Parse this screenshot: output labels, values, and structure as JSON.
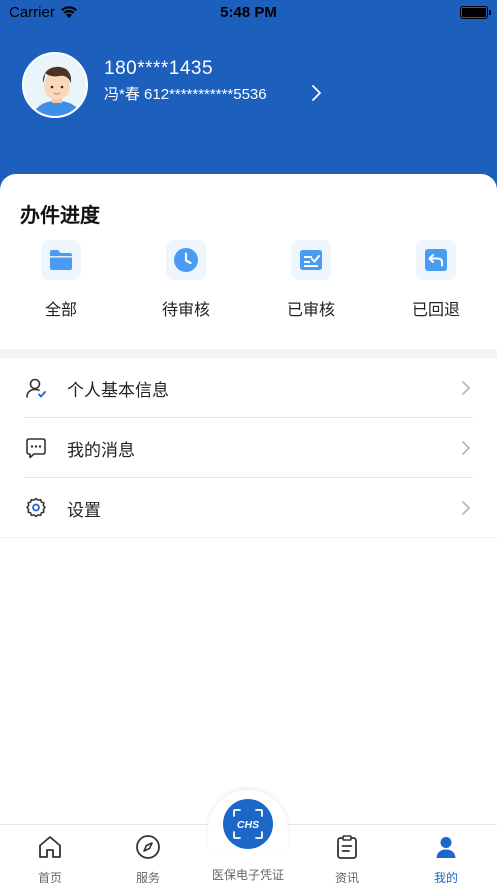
{
  "status_bar": {
    "carrier": "Carrier",
    "time": "5:48 PM"
  },
  "profile": {
    "phone": "180****1435",
    "sub_info": "冯*春 612***********5536"
  },
  "progress": {
    "title": "办件进度",
    "items": [
      {
        "label": "全部",
        "icon": "folder-icon"
      },
      {
        "label": "待审核",
        "icon": "clock-icon"
      },
      {
        "label": "已审核",
        "icon": "checked-document-icon"
      },
      {
        "label": "已回退",
        "icon": "return-arrow-icon"
      }
    ]
  },
  "menu": [
    {
      "label": "个人基本信息",
      "icon": "user-verified-icon"
    },
    {
      "label": "我的消息",
      "icon": "chat-bubble-icon"
    },
    {
      "label": "设置",
      "icon": "gear-icon"
    }
  ],
  "tabbar": {
    "items": [
      {
        "label": "首页",
        "icon": "home-icon"
      },
      {
        "label": "服务",
        "icon": "compass-icon"
      },
      {
        "label": "医保电子凭证",
        "icon": "chs-scan-icon",
        "badge_text": "CHS"
      },
      {
        "label": "资讯",
        "icon": "clipboard-icon"
      },
      {
        "label": "我的",
        "icon": "person-icon"
      }
    ],
    "active_index": 4
  },
  "colors": {
    "brand_blue": "#1d5fbd",
    "accent_blue": "#1d67c9",
    "icon_blue": "#4a9cf2"
  }
}
